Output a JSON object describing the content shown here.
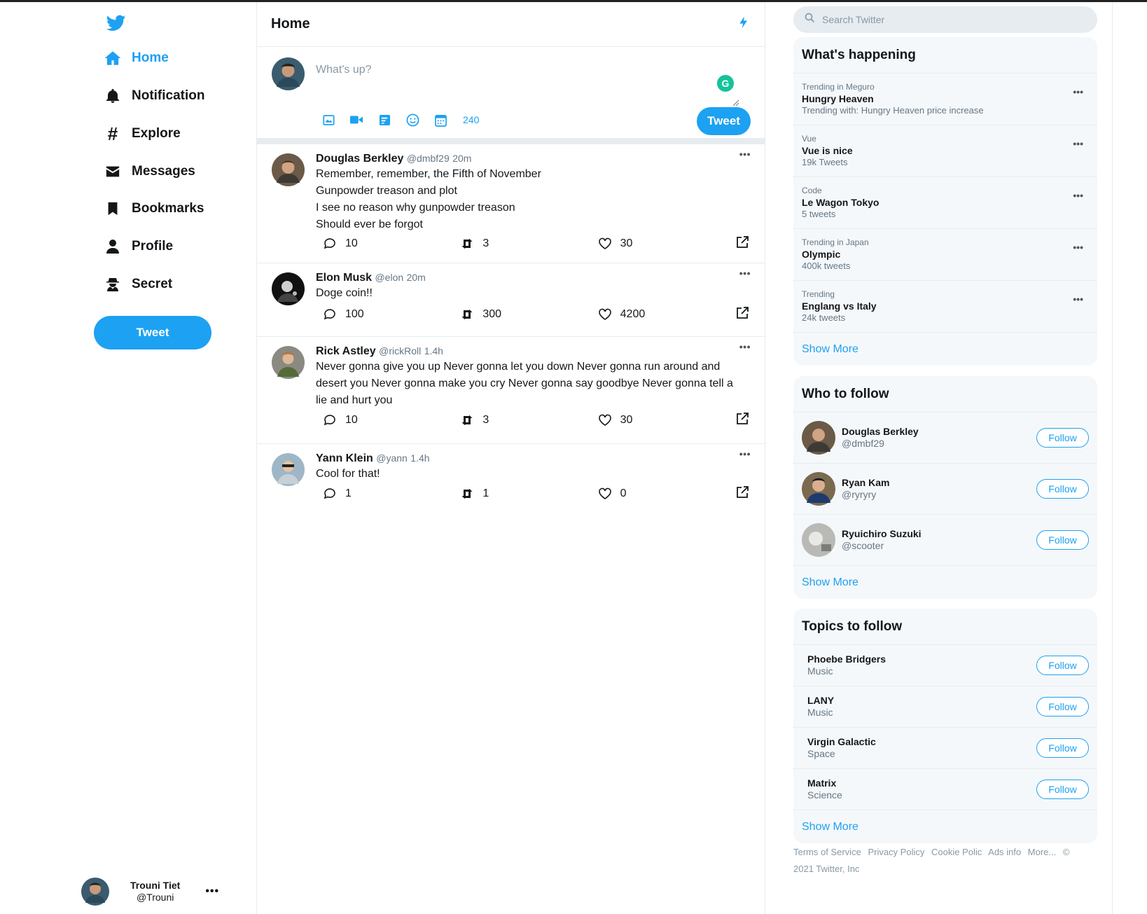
{
  "sidebar": {
    "nav": [
      {
        "label": "Home",
        "icon": "home-icon"
      },
      {
        "label": "Notification",
        "icon": "bell-icon"
      },
      {
        "label": "Explore",
        "icon": "hashtag-icon"
      },
      {
        "label": "Messages",
        "icon": "envelope-icon"
      },
      {
        "label": "Bookmarks",
        "icon": "bookmark-icon"
      },
      {
        "label": "Profile",
        "icon": "user-icon"
      },
      {
        "label": "Secret",
        "icon": "spy-icon"
      }
    ],
    "tweet_button": "Tweet",
    "account": {
      "name": "Trouni Tiet",
      "handle": "@Trouni",
      "more": "•••"
    }
  },
  "main": {
    "title": "Home",
    "compose": {
      "placeholder": "What's up?",
      "char_count": "240",
      "tweet_button": "Tweet",
      "grammarly": "G"
    },
    "tweets": [
      {
        "name": "Douglas Berkley",
        "handle": "@dmbf29",
        "time": "20m",
        "text": "Remember, remember, the Fifth of November\nGunpowder treason and plot\nI see no reason why gunpowder treason\nShould ever be forgot",
        "replies": "10",
        "retweets": "3",
        "likes": "30",
        "more": "•••"
      },
      {
        "name": "Elon Musk",
        "handle": "@elon",
        "time": "20m",
        "text": "Doge coin!!",
        "replies": "100",
        "retweets": "300",
        "likes": "4200",
        "more": "•••"
      },
      {
        "name": "Rick Astley",
        "handle": "@rickRoll",
        "time": "1.4h",
        "text": "Never gonna give you up Never gonna let you down Never gonna run around and desert you Never gonna make you cry Never gonna say goodbye Never gonna tell a lie and hurt you",
        "replies": "10",
        "retweets": "3",
        "likes": "30",
        "more": "•••"
      },
      {
        "name": "Yann Klein",
        "handle": "@yann",
        "time": "1.4h",
        "text": "Cool for that!",
        "replies": "1",
        "retweets": "1",
        "likes": "0",
        "more": "•••"
      }
    ]
  },
  "right": {
    "search_placeholder": "Search Twitter",
    "happening": {
      "title": "What's happening",
      "items": [
        {
          "context": "Trending in Meguro",
          "title": "Hungry Heaven",
          "sub": "Trending with: Hungry Heaven price increase"
        },
        {
          "context": "Vue",
          "title": "Vue is nice",
          "sub": "19k Tweets"
        },
        {
          "context": "Code",
          "title": "Le Wagon Tokyo",
          "sub": "5 tweets"
        },
        {
          "context": "Trending in Japan",
          "title": "Olympic",
          "sub": "400k tweets"
        },
        {
          "context": "Trending",
          "title": "Englang vs Italy",
          "sub": "24k tweets"
        }
      ],
      "more_dots": "•••",
      "show_more": "Show More"
    },
    "who_to_follow": {
      "title": "Who to follow",
      "users": [
        {
          "name": "Douglas Berkley",
          "handle": "@dmbf29",
          "button": "Follow"
        },
        {
          "name": "Ryan Kam",
          "handle": "@ryryry",
          "button": "Follow"
        },
        {
          "name": "Ryuichiro Suzuki",
          "handle": "@scooter",
          "button": "Follow"
        }
      ],
      "show_more": "Show More"
    },
    "topics": {
      "title": "Topics to follow",
      "items": [
        {
          "name": "Phoebe Bridgers",
          "category": "Music",
          "button": "Follow"
        },
        {
          "name": "LANY",
          "category": "Music",
          "button": "Follow"
        },
        {
          "name": "Virgin Galactic",
          "category": "Space",
          "button": "Follow"
        },
        {
          "name": "Matrix",
          "category": "Science",
          "button": "Follow"
        }
      ],
      "show_more": "Show More"
    },
    "footer": {
      "links": [
        "Terms of Service",
        "Privacy Policy",
        "Cookie Polic",
        "Ads info",
        "More...",
        "©"
      ],
      "copyright": "2021 Twitter, Inc"
    }
  },
  "colors": {
    "accent": "#1da1f2",
    "text": "#14171a",
    "muted": "#657786",
    "panel": "#f5f8fa",
    "border": "#e6ecf0"
  }
}
